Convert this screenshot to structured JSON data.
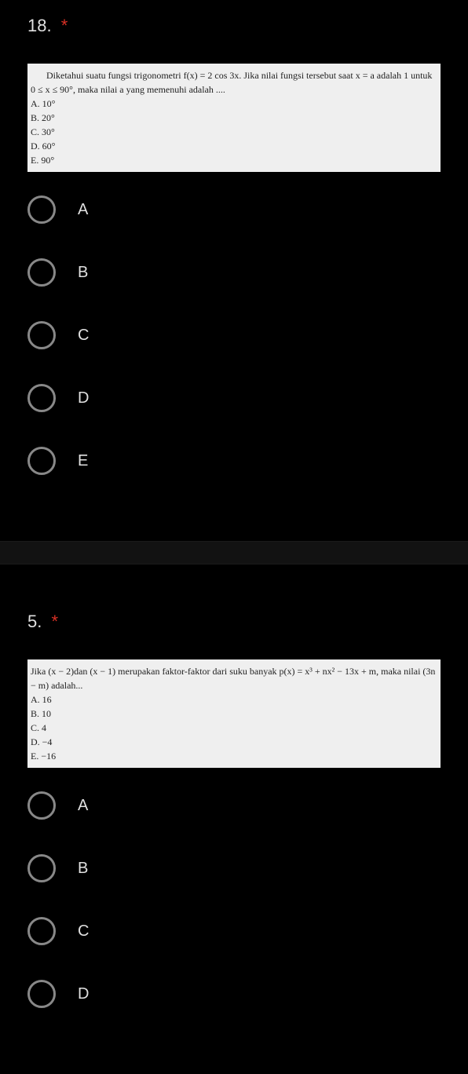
{
  "questions": [
    {
      "number": "18.",
      "required_mark": "*",
      "problem": {
        "prompt": "Diketahui suatu fungsi trigonometri f(x) = 2 cos 3x. Jika nilai fungsi tersebut saat x = a adalah 1 untuk 0 ≤ x ≤ 90°, maka nilai a yang memenuhi adalah ....",
        "img_choices": [
          "A.  10°",
          "B.  20°",
          "C.  30°",
          "D.  60°",
          "E.  90°"
        ]
      },
      "options": [
        {
          "label": "A"
        },
        {
          "label": "B"
        },
        {
          "label": "C"
        },
        {
          "label": "D"
        },
        {
          "label": "E"
        }
      ]
    },
    {
      "number": "5.",
      "required_mark": "*",
      "problem": {
        "prompt": "Jika (x − 2)dan (x − 1) merupakan faktor-faktor dari suku banyak p(x) = x³ + nx² − 13x + m, maka nilai (3n − m) adalah...",
        "img_choices": [
          "A.  16",
          "B.  10",
          "C.  4",
          "D.  −4",
          "E.  −16"
        ]
      },
      "options": [
        {
          "label": "A"
        },
        {
          "label": "B"
        },
        {
          "label": "C"
        },
        {
          "label": "D"
        }
      ]
    }
  ]
}
